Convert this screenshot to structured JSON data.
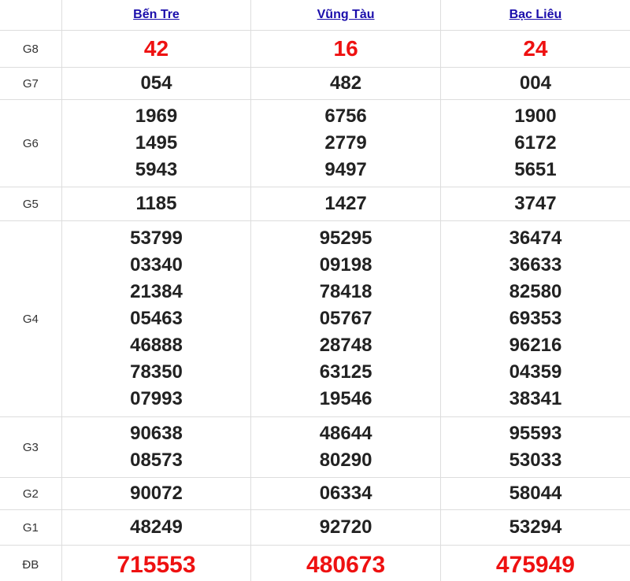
{
  "provinces": [
    "Bến Tre",
    "Vũng Tàu",
    "Bạc Liêu"
  ],
  "prize_labels": {
    "g8": "G8",
    "g7": "G7",
    "g6": "G6",
    "g5": "G5",
    "g4": "G4",
    "g3": "G3",
    "g2": "G2",
    "g1": "G1",
    "db": "ĐB"
  },
  "results": {
    "g8": [
      [
        "42"
      ],
      [
        "16"
      ],
      [
        "24"
      ]
    ],
    "g7": [
      [
        "054"
      ],
      [
        "482"
      ],
      [
        "004"
      ]
    ],
    "g6": [
      [
        "1969",
        "1495",
        "5943"
      ],
      [
        "6756",
        "2779",
        "9497"
      ],
      [
        "1900",
        "6172",
        "5651"
      ]
    ],
    "g5": [
      [
        "1185"
      ],
      [
        "1427"
      ],
      [
        "3747"
      ]
    ],
    "g4": [
      [
        "53799",
        "03340",
        "21384",
        "05463",
        "46888",
        "78350",
        "07993"
      ],
      [
        "95295",
        "09198",
        "78418",
        "05767",
        "28748",
        "63125",
        "19546"
      ],
      [
        "36474",
        "36633",
        "82580",
        "69353",
        "96216",
        "04359",
        "38341"
      ]
    ],
    "g3": [
      [
        "90638",
        "08573"
      ],
      [
        "48644",
        "80290"
      ],
      [
        "95593",
        "53033"
      ]
    ],
    "g2": [
      [
        "90072"
      ],
      [
        "06334"
      ],
      [
        "58044"
      ]
    ],
    "g1": [
      [
        "48249"
      ],
      [
        "92720"
      ],
      [
        "53294"
      ]
    ],
    "db": [
      [
        "715553"
      ],
      [
        "480673"
      ],
      [
        "475949"
      ]
    ]
  },
  "colors": {
    "header_link": "#1a0dab",
    "highlight_number": "#ee1111",
    "number": "#222222",
    "border": "#dddddd"
  }
}
